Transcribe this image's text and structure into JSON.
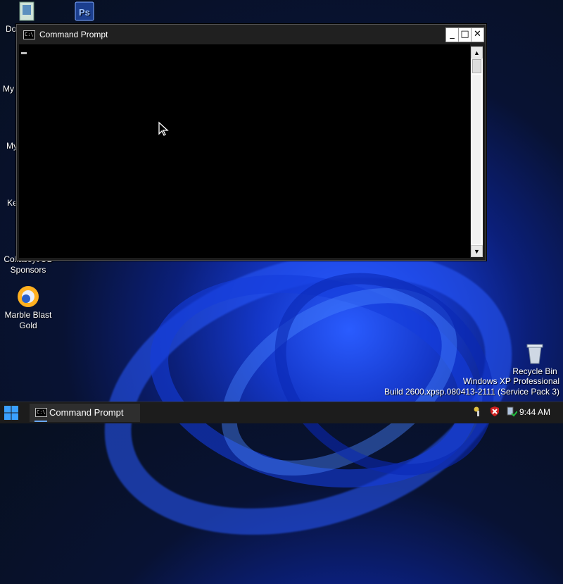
{
  "desktop": {
    "icons": [
      {
        "label": "Do"
      },
      {
        "label": ""
      },
      {
        "label": "My"
      },
      {
        "label": "My"
      },
      {
        "label": "Ke"
      },
      {
        "label": "CollabsyJOB Sponsors"
      },
      {
        "label": "Marble Blast Gold"
      },
      {
        "label": "Recycle Bin"
      }
    ],
    "photoshop_icon": "Ps",
    "os_info": {
      "line1": "Windows XP Professional",
      "line2": "Build 2600.xpsp.080413-2111 (Service Pack 3)"
    }
  },
  "window": {
    "title": "Command Prompt",
    "icon_text": "C:\\",
    "minimize": "_",
    "maximize": "□",
    "close": "✕",
    "scroll_up": "▲",
    "scroll_down": "▼"
  },
  "taskbar": {
    "task_label": "Command Prompt",
    "clock": "9:44 AM"
  },
  "icons": {
    "start": "windows-logo-icon",
    "tray": [
      "network-key-icon",
      "security-shield-icon",
      "safely-remove-hardware-icon"
    ]
  },
  "colors": {
    "accent": "#6aa8ff",
    "wallpaper_blue": "#1437c9",
    "console_bg": "#000000",
    "taskbar": "#1c1c1c"
  }
}
